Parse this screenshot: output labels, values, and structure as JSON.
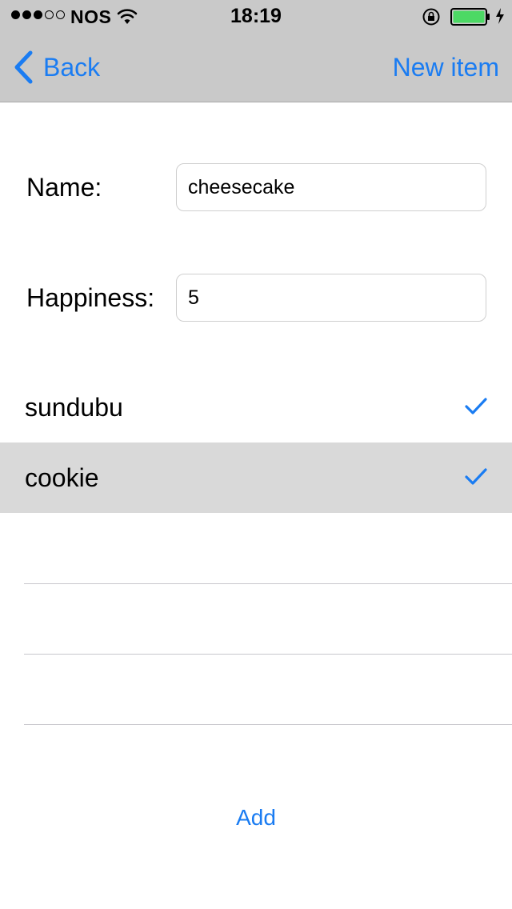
{
  "status_bar": {
    "signal_dots": [
      true,
      true,
      true,
      false,
      false
    ],
    "carrier": "NOS",
    "time": "18:19",
    "wifi_icon": "wifi-icon",
    "lock_icon": "orientation-lock-icon",
    "battery_icon": "battery-icon",
    "charging_icon": "bolt-icon",
    "battery_color": "#4cd964"
  },
  "nav": {
    "back_label": "Back",
    "new_item_label": "New item"
  },
  "form": {
    "name_label": "Name:",
    "name_value": "cheesecake",
    "happiness_label": "Happiness:",
    "happiness_value": "5"
  },
  "list": {
    "items": [
      {
        "label": "sundubu",
        "checked": true,
        "selected": false
      },
      {
        "label": "cookie",
        "checked": true,
        "selected": true
      }
    ],
    "check_icon": "checkmark-icon"
  },
  "add_label": "Add",
  "colors": {
    "accent": "#1a7cf2",
    "header_bg": "#c9c9c9",
    "selected_row_bg": "#d9d9d9"
  }
}
